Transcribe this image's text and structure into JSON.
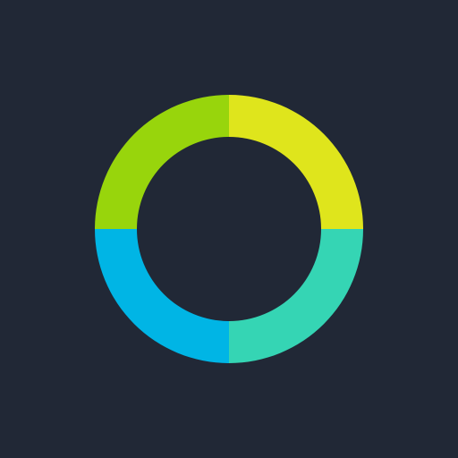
{
  "background_color": "#212836",
  "logo": {
    "icon": "circular-ring-logo-icon",
    "segments": [
      {
        "name": "top-left",
        "color": "#98D50C"
      },
      {
        "name": "top-right",
        "color": "#DFE51C"
      },
      {
        "name": "bottom-right",
        "color": "#35D5B4"
      },
      {
        "name": "bottom-left",
        "color": "#00B5E5"
      }
    ]
  }
}
